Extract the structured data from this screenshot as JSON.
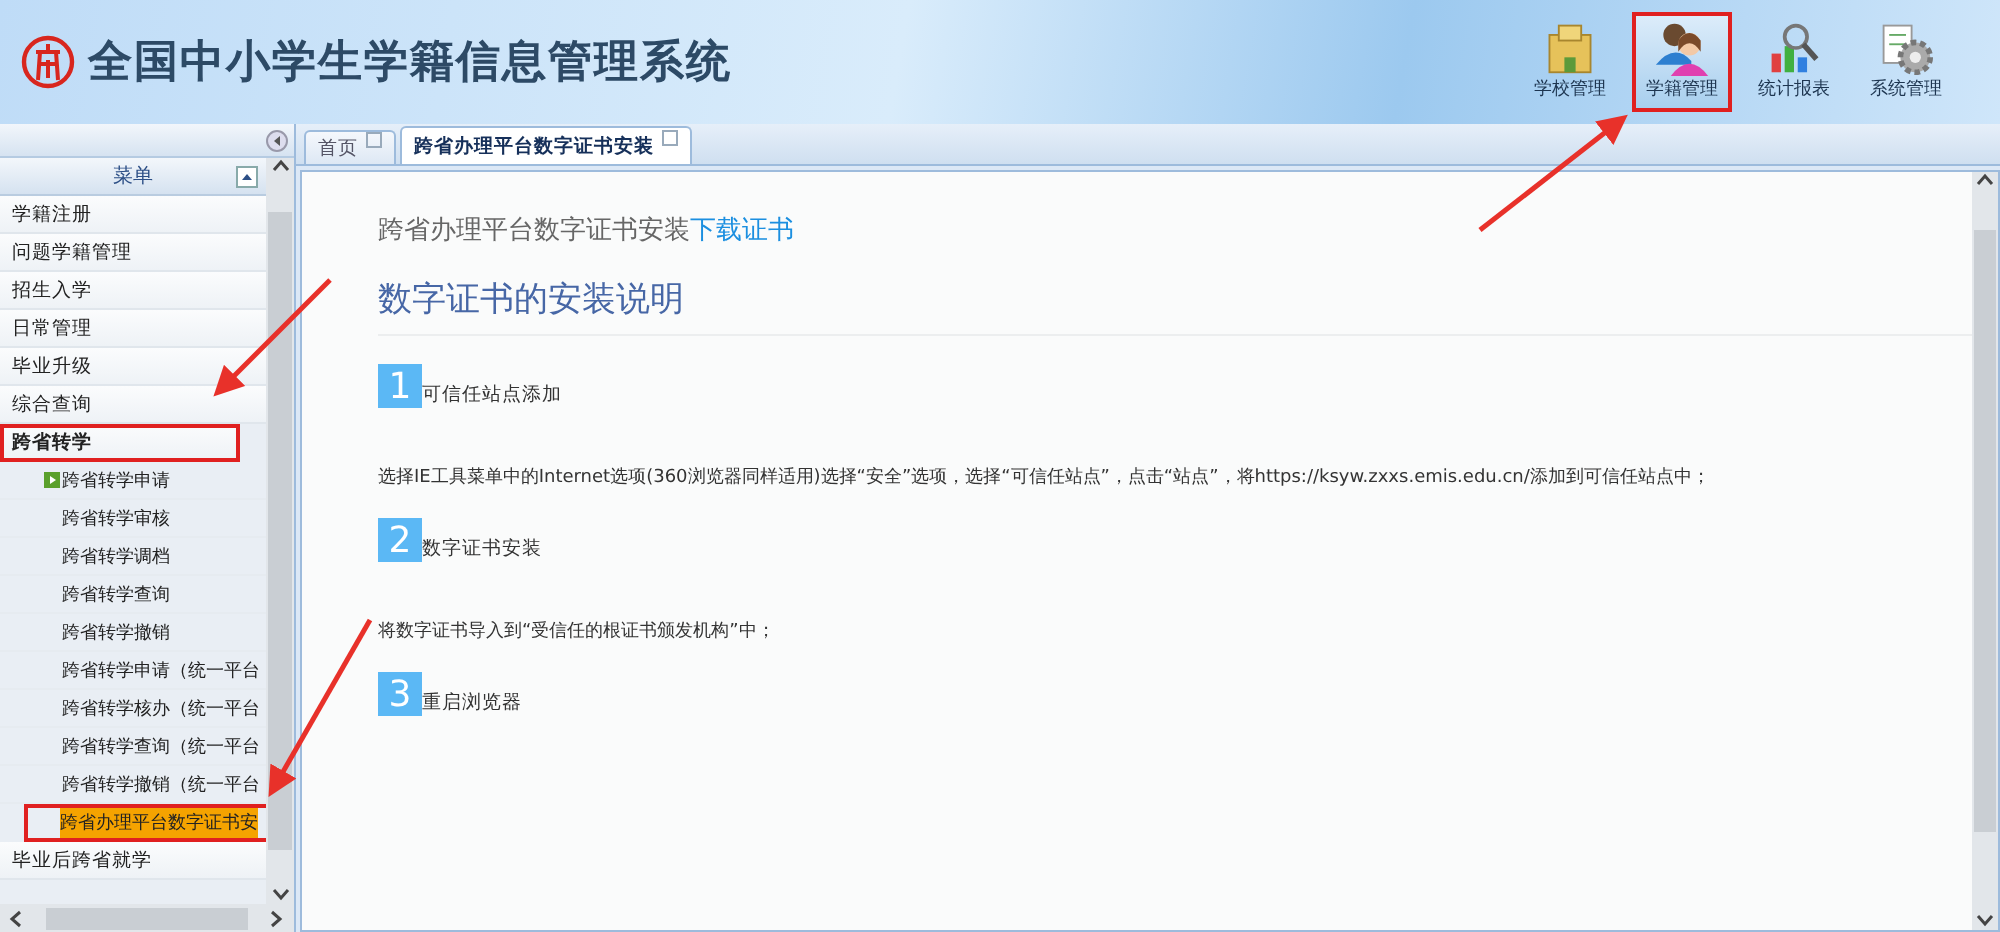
{
  "header": {
    "title": "全国中小学生学籍信息管理系统",
    "nav": [
      {
        "label": "学校管理",
        "kind": "school",
        "selected": false
      },
      {
        "label": "学籍管理",
        "kind": "people",
        "selected": true
      },
      {
        "label": "统计报表",
        "kind": "chart",
        "selected": false
      },
      {
        "label": "系统管理",
        "kind": "gear",
        "selected": false
      }
    ]
  },
  "sidebar": {
    "title": "菜单",
    "items": [
      {
        "label": "学籍注册",
        "highlighted": false
      },
      {
        "label": "问题学籍管理",
        "highlighted": false
      },
      {
        "label": "招生入学",
        "highlighted": false
      },
      {
        "label": "日常管理",
        "highlighted": false
      },
      {
        "label": "毕业升级",
        "highlighted": false
      },
      {
        "label": "综合查询",
        "highlighted": false
      },
      {
        "label": "跨省转学",
        "highlighted": true,
        "expanded": true,
        "children": [
          {
            "label": "跨省转学申请",
            "kind": "arrow",
            "selected": false
          },
          {
            "label": "跨省转学审核",
            "kind": "plain",
            "selected": false
          },
          {
            "label": "跨省转学调档",
            "kind": "plain",
            "selected": false
          },
          {
            "label": "跨省转学查询",
            "kind": "plain",
            "selected": false
          },
          {
            "label": "跨省转学撤销",
            "kind": "plain",
            "selected": false
          },
          {
            "label": "跨省转学申请（统一平台",
            "kind": "plain",
            "selected": false
          },
          {
            "label": "跨省转学核办（统一平台",
            "kind": "plain",
            "selected": false
          },
          {
            "label": "跨省转学查询（统一平台",
            "kind": "plain",
            "selected": false
          },
          {
            "label": "跨省转学撤销（统一平台",
            "kind": "plain",
            "selected": false
          },
          {
            "label": "跨省办理平台数字证书安",
            "kind": "plain",
            "selected": true
          }
        ]
      },
      {
        "label": "毕业后跨省就学",
        "highlighted": false
      }
    ]
  },
  "tabs": [
    {
      "label": "首页",
      "selected": false
    },
    {
      "label": "跨省办理平台数字证书安装",
      "selected": true
    }
  ],
  "content": {
    "intro": "跨省办理平台数字证书安装",
    "intro_link": "下载证书",
    "heading": "数字证书的安装说明",
    "steps": [
      {
        "number": "1",
        "title": "可信任站点添加",
        "text": "选择IE工具菜单中的Internet选项(360浏览器同样适用)选择“安全”选项，选择“可信任站点”，点击“站点”，将https://ksyw.zxxs.emis.edu.cn/添加到可信任站点中；"
      },
      {
        "number": "2",
        "title": "数字证书安装",
        "text": "将数字证书导入到“受信任的根证书颁发机构”中；"
      },
      {
        "number": "3",
        "title": "重启浏览器"
      }
    ]
  }
}
